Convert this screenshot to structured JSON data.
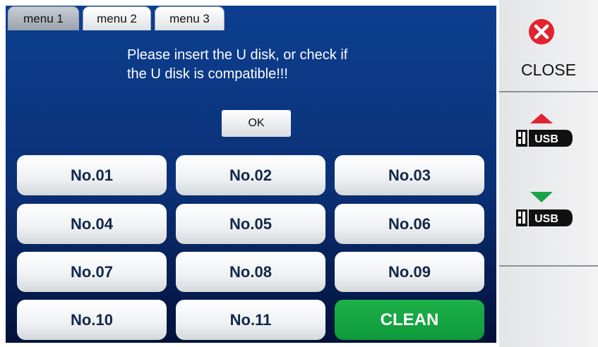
{
  "tabs": [
    {
      "label": "menu 1",
      "active": true
    },
    {
      "label": "menu 2",
      "active": false
    },
    {
      "label": "menu 3",
      "active": false
    }
  ],
  "message": {
    "line1": "Please insert the U disk, or check if",
    "line2": "the U disk is compatible!!!"
  },
  "ok_label": "OK",
  "grid": [
    "No.01",
    "No.02",
    "No.03",
    "No.04",
    "No.05",
    "No.06",
    "No.07",
    "No.08",
    "No.09",
    "No.10",
    "No.11"
  ],
  "clean_label": "CLEAN",
  "sidebar": {
    "close_label": "CLOSE",
    "usb_label": "USB",
    "usb_upload_arrow_color": "#e0232f",
    "usb_download_arrow_color": "#1aa34a",
    "close_icon_color": "#e0232f"
  }
}
